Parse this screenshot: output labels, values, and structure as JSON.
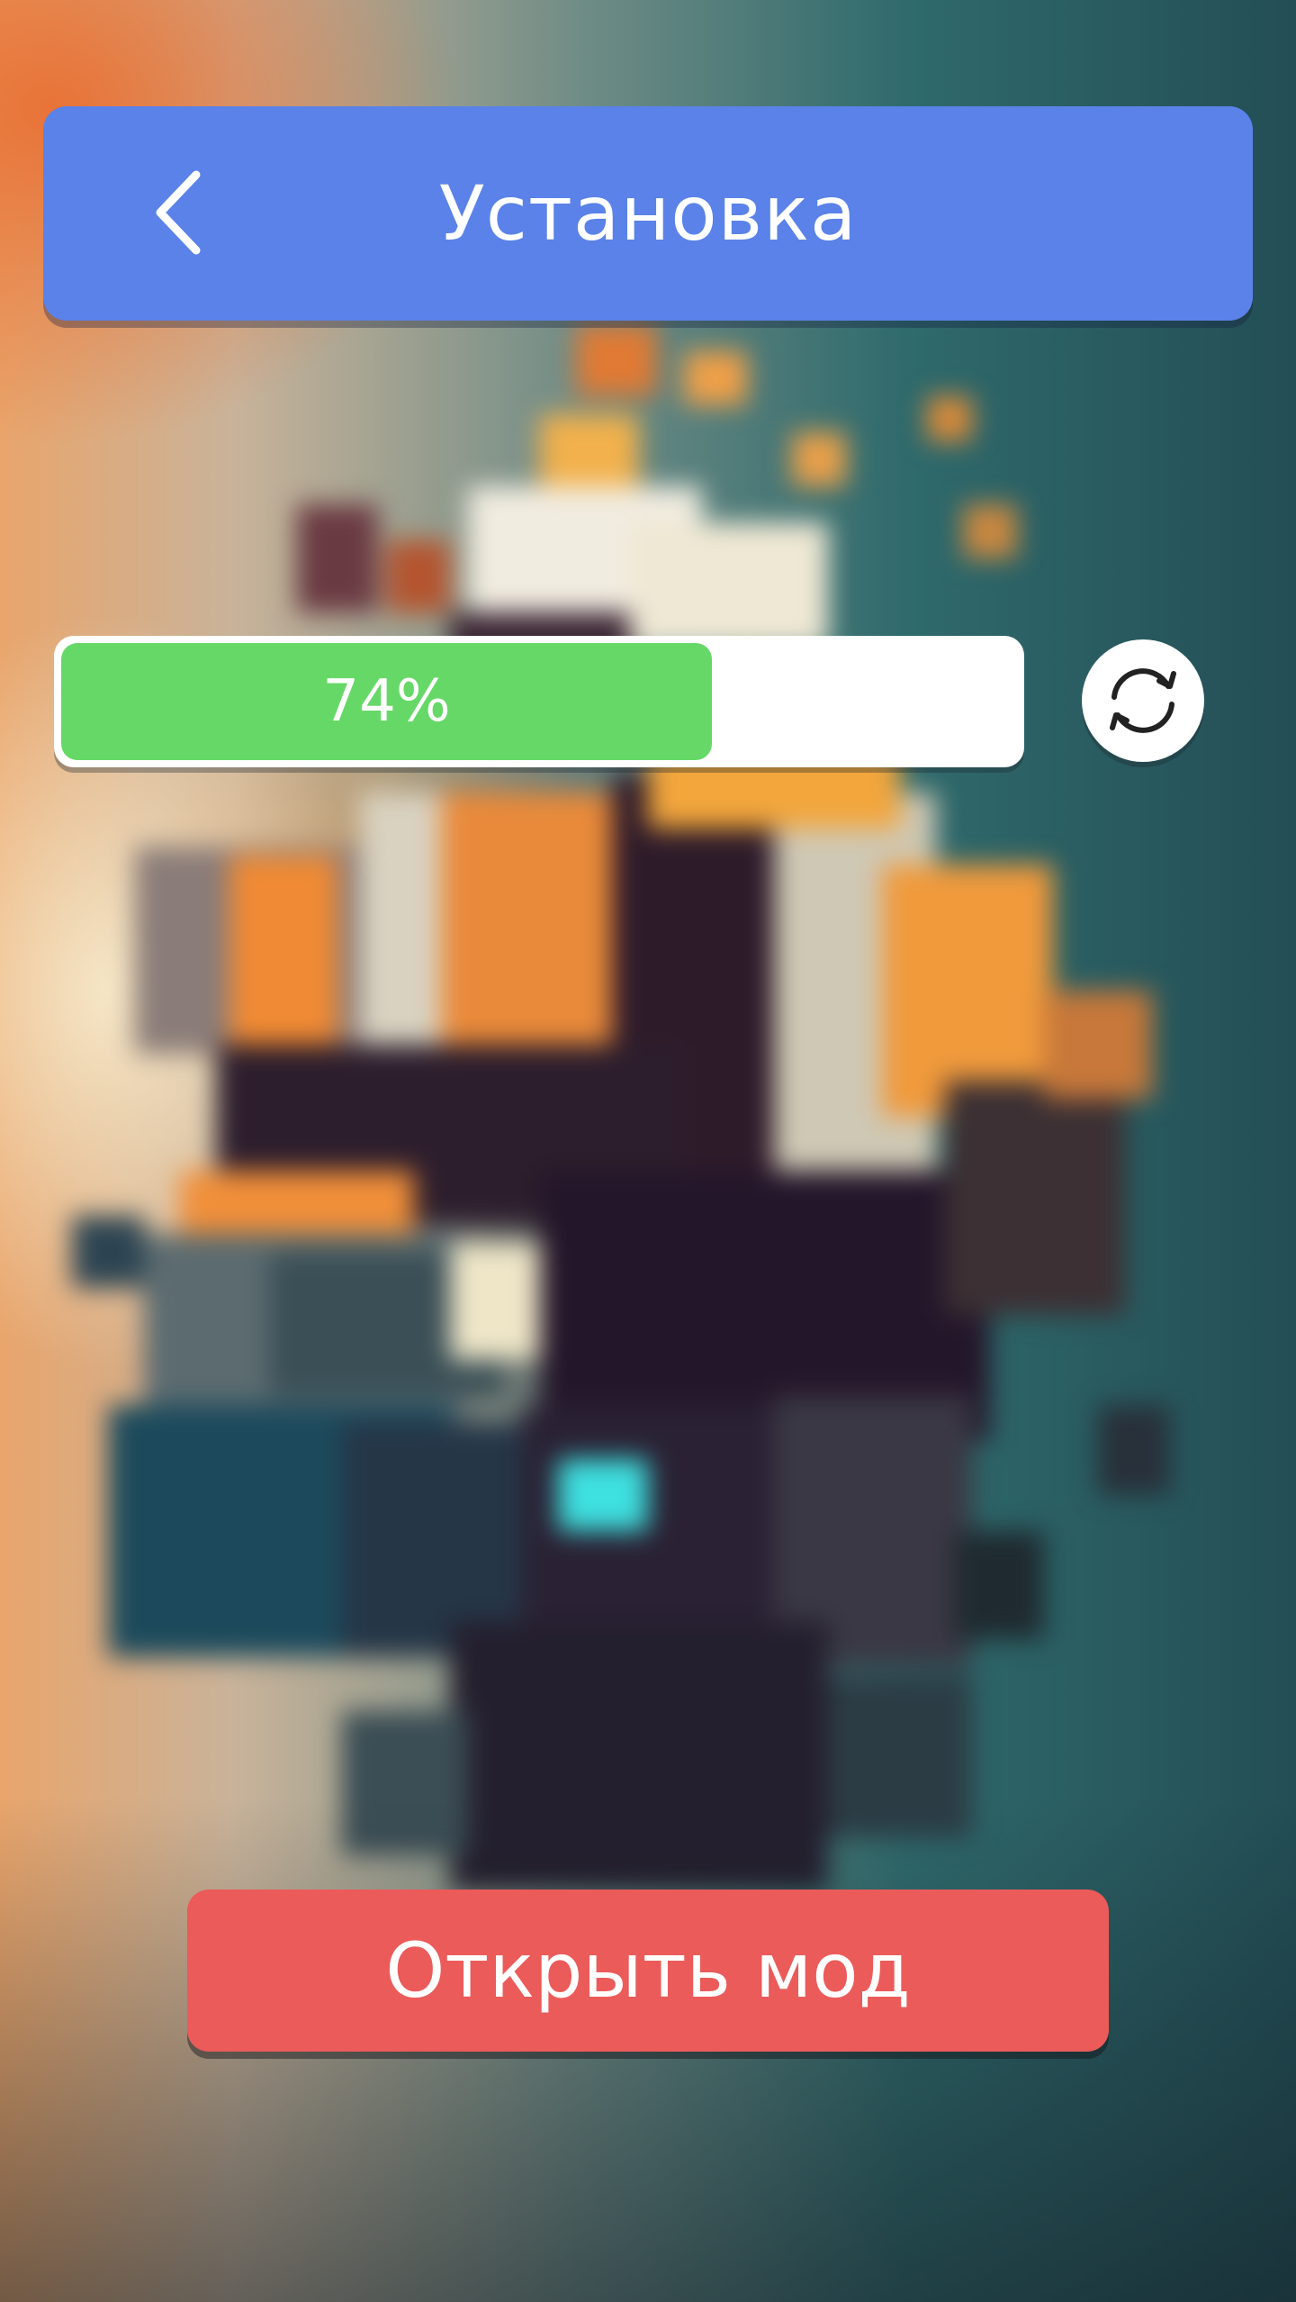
{
  "header": {
    "title": "Установка",
    "back_icon": "chevron-left-icon",
    "color": "#5a82e8"
  },
  "progress": {
    "percent": 74,
    "label": "74%",
    "fill_color": "#66d867",
    "refresh_icon": "refresh-icon"
  },
  "actions": {
    "open_label": "Открыть мод",
    "open_color": "#eb5b5a"
  },
  "background": {
    "description_icon": "blurred-voxel-artwork"
  }
}
